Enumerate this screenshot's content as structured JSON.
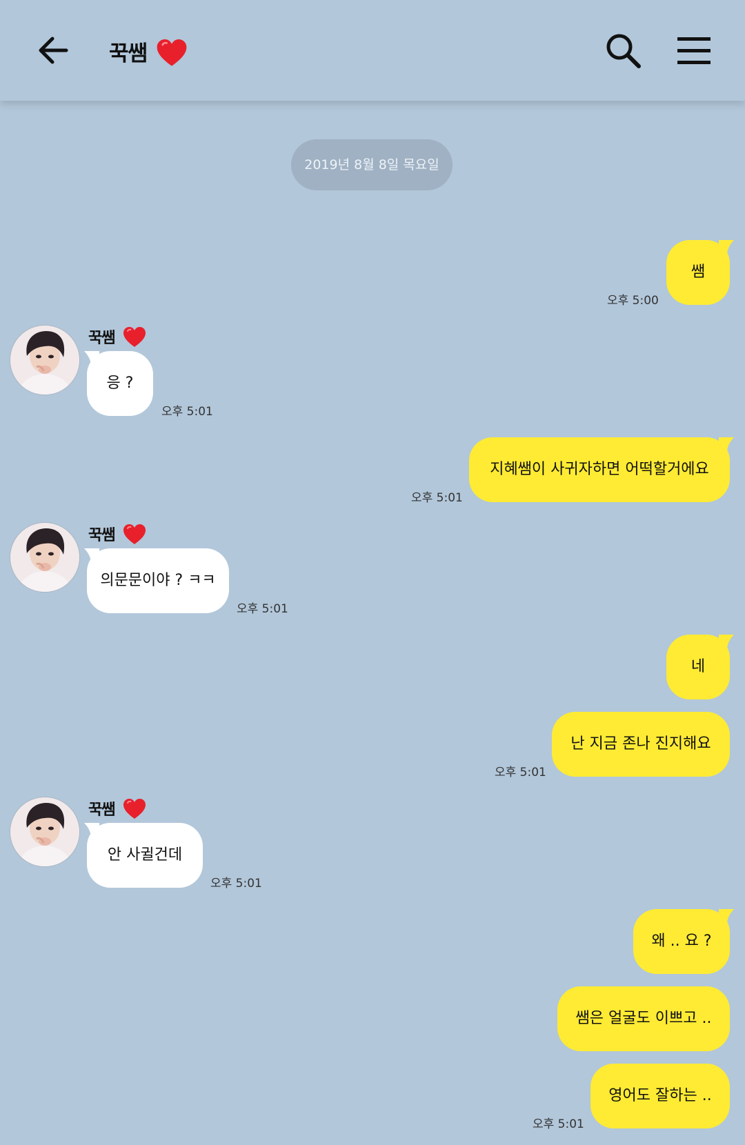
{
  "header": {
    "title": "꾹쌤",
    "back_icon": "arrow-left-icon",
    "search_icon": "search-icon",
    "menu_icon": "hamburger-menu-icon"
  },
  "date_divider": "2019년 8월 8일 목요일",
  "colors": {
    "background": "#b2c7da",
    "my_bubble": "#ffeb33",
    "their_bubble": "#ffffff",
    "heart": "#e8202c"
  },
  "messages": [
    {
      "from": "me",
      "text": "쌤",
      "time": "오후 5:00"
    },
    {
      "from": "them",
      "sender": "꾹쌤",
      "text": "응 ?",
      "time": "오후 5:01"
    },
    {
      "from": "me",
      "text": "지혜쌤이 사귀자하면 어떡할거에요",
      "time": "오후 5:01"
    },
    {
      "from": "them",
      "sender": "꾹쌤",
      "text": "의문문이야 ? ㅋㅋ",
      "time": "오후 5:01"
    },
    {
      "from": "me",
      "text": "네"
    },
    {
      "from": "me",
      "text": "난 지금 존나 진지해요",
      "time": "오후 5:01"
    },
    {
      "from": "them",
      "sender": "꾹쌤",
      "text": "안 사귈건데",
      "time": "오후 5:01"
    },
    {
      "from": "me",
      "text": "왜 .. 요 ?"
    },
    {
      "from": "me",
      "text": "쌤은 얼굴도 이쁘고 .."
    },
    {
      "from": "me",
      "text": "영어도 잘하는 ..",
      "time": "오후 5:01"
    }
  ]
}
